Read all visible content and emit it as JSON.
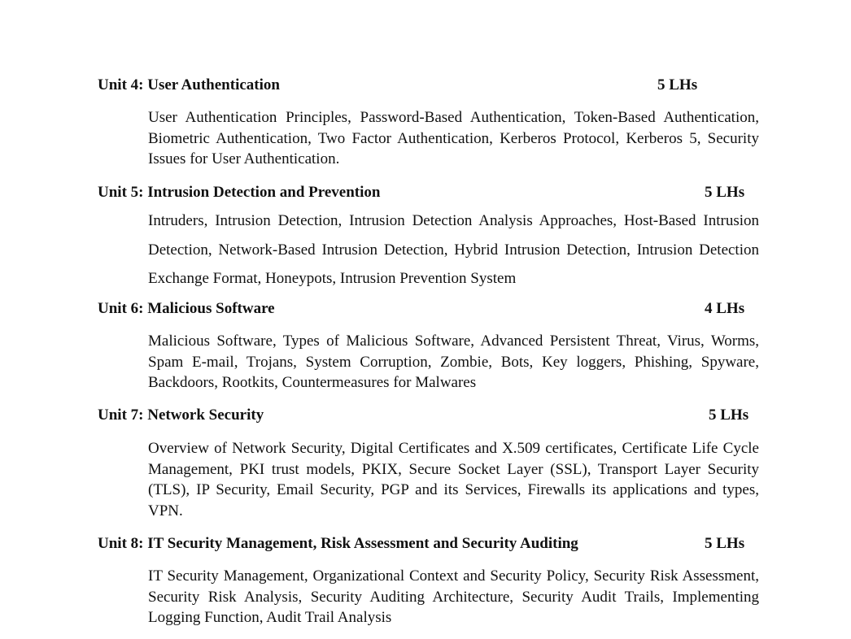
{
  "units": [
    {
      "title": "Unit 4: User Authentication",
      "hours": "5 LHs",
      "description": "User Authentication Principles, Password-Based Authentication, Token-Based Authentication, Biometric Authentication, Two Factor Authentication, Kerberos Protocol, Kerberos 5, Security Issues for User Authentication."
    },
    {
      "title": "Unit 5: Intrusion Detection and Prevention",
      "hours": "5 LHs",
      "description": "Intruders, Intrusion Detection, Intrusion Detection Analysis Approaches, Host-Based Intrusion Detection, Network-Based Intrusion Detection, Hybrid Intrusion Detection, Intrusion Detection Exchange Format, Honeypots, Intrusion Prevention System"
    },
    {
      "title": "Unit 6: Malicious Software",
      "hours": "4 LHs",
      "description": "Malicious Software, Types of Malicious Software, Advanced Persistent Threat, Virus, Worms, Spam E-mail, Trojans, System Corruption, Zombie, Bots, Key loggers, Phishing, Spyware, Backdoors, Rootkits, Countermeasures for Malwares"
    },
    {
      "title": "Unit 7: Network Security",
      "hours": "5 LHs",
      "description": "Overview of Network Security, Digital Certificates and X.509 certificates, Certificate Life Cycle Management, PKI trust models, PKIX, Secure Socket Layer (SSL), Transport Layer Security (TLS), IP Security, Email Security, PGP and its Services, Firewalls its applications and types, VPN."
    },
    {
      "title": "Unit 8: IT Security Management, Risk Assessment and Security Auditing",
      "hours": "5 LHs",
      "description": "IT Security Management, Organizational Context and Security Policy, Security Risk Assessment, Security Risk Analysis, Security Auditing Architecture, Security Audit Trails, Implementing Logging Function, Audit Trail Analysis"
    }
  ]
}
